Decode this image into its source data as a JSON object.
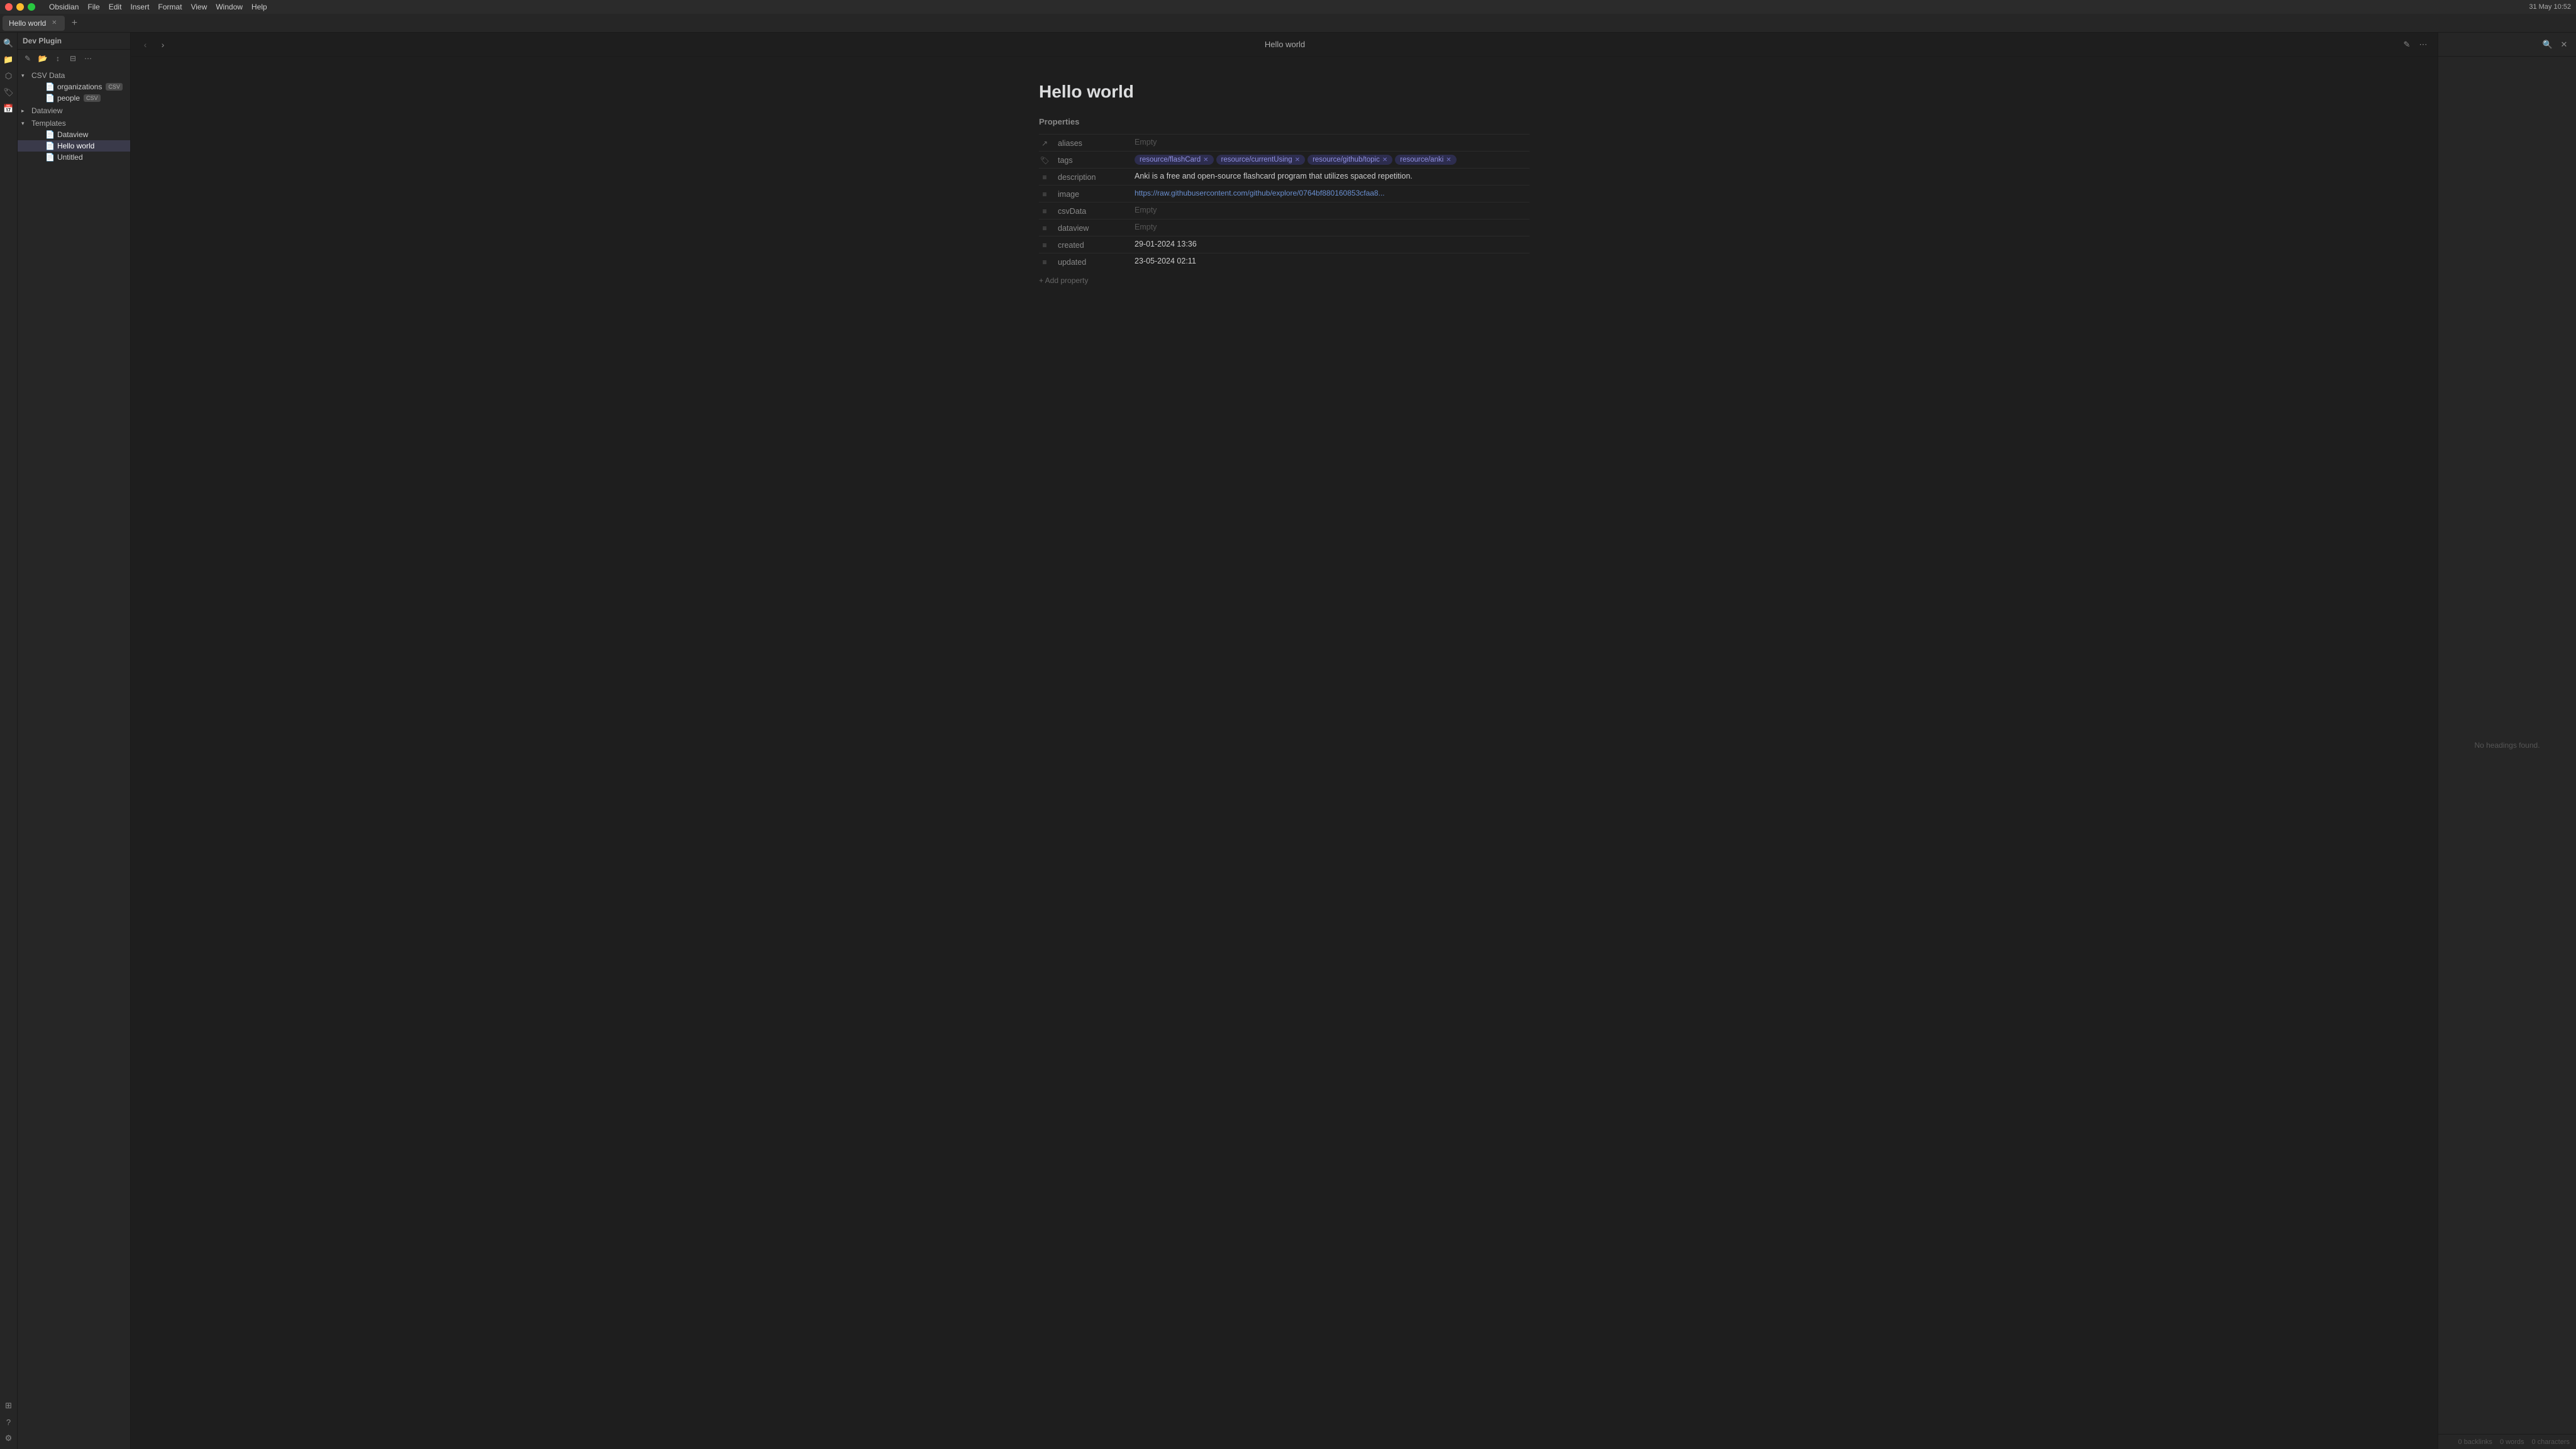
{
  "menubar": {
    "app": "Obsidian",
    "menus": [
      "Obsidian",
      "File",
      "Edit",
      "Insert",
      "Format",
      "View",
      "Window",
      "Help"
    ],
    "right_info": "31 May 10:52"
  },
  "tabbar": {
    "active_tab": "Hello world",
    "tabs": [
      {
        "label": "Hello world",
        "active": true
      }
    ],
    "new_tab_label": "+"
  },
  "sidebar": {
    "header": "Dev Plugin",
    "sections": [
      {
        "label": "CSV Data",
        "expanded": true,
        "items": [
          {
            "label": "organizations",
            "badge": "CSV",
            "sub": true
          },
          {
            "label": "people",
            "badge": "CSV",
            "sub": true
          }
        ]
      },
      {
        "label": "Dataview",
        "expanded": false,
        "items": []
      },
      {
        "label": "Templates",
        "expanded": true,
        "items": [
          {
            "label": "Dataview",
            "sub": true
          },
          {
            "label": "Hello world",
            "sub": true,
            "active": true
          },
          {
            "label": "Untitled",
            "sub": true
          }
        ]
      }
    ]
  },
  "note": {
    "title": "Hello world",
    "nav_title": "Hello world",
    "properties_label": "Properties",
    "properties": [
      {
        "icon": "↗",
        "key": "aliases",
        "value": "Empty",
        "empty": true,
        "type": "text"
      },
      {
        "icon": "🏷",
        "key": "tags",
        "type": "tags",
        "tags": [
          {
            "label": "resource/flashCard"
          },
          {
            "label": "resource/currentUsing"
          },
          {
            "label": "resource/github/topic"
          },
          {
            "label": "resource/anki"
          }
        ]
      },
      {
        "icon": "≡",
        "key": "description",
        "value": "Anki is a free and open-source flashcard program that utilizes spaced repetition.",
        "type": "text"
      },
      {
        "icon": "≡",
        "key": "image",
        "value": "https://raw.githubusercontent.com/github/explore/0764bf880160853cfaa8...",
        "type": "link",
        "link": "https://raw.githubusercontent.com/github/explore/0764bf880160853cfaa8..."
      },
      {
        "icon": "≡",
        "key": "csvData",
        "value": "Empty",
        "empty": true,
        "type": "text"
      },
      {
        "icon": "≡",
        "key": "dataview",
        "value": "Empty",
        "empty": true,
        "type": "text"
      },
      {
        "icon": "≡",
        "key": "created",
        "value": "29-01-2024 13:36",
        "type": "text"
      },
      {
        "icon": "≡",
        "key": "updated",
        "value": "23-05-2024 02:11",
        "type": "text"
      }
    ],
    "add_property_label": "+ Add property"
  },
  "right_panel": {
    "no_headings": "No headings found.",
    "footer": {
      "backlinks": "0 backlinks",
      "words": "0 words",
      "chars": "0 characters"
    }
  }
}
